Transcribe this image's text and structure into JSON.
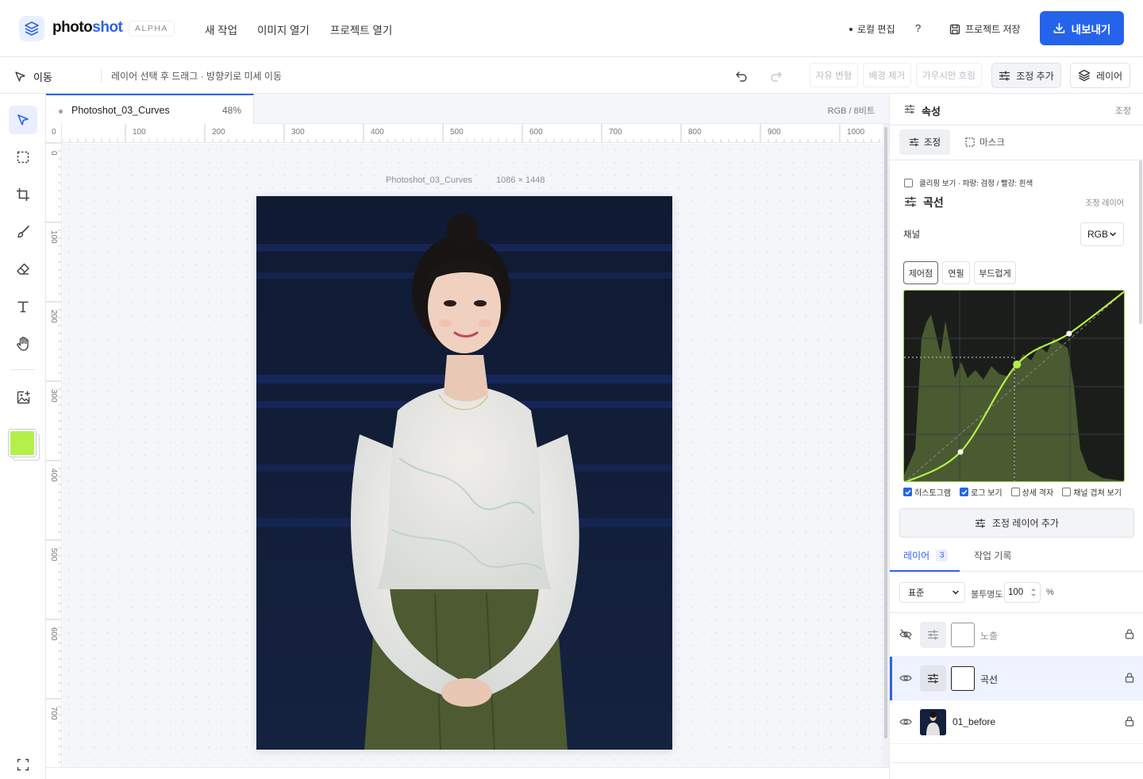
{
  "header": {
    "brand_main": "photo",
    "brand_accent": "shot",
    "badge": "ALPHA",
    "nav": [
      "새 작업",
      "이미지 열기",
      "프로젝트 열기"
    ],
    "local_edit": "로컬 편집",
    "help": "?",
    "save_project": "프로젝트 저장",
    "export": "내보내기"
  },
  "toolbar": {
    "tool_name": "이동",
    "hint": "레이어 선택 후 드래그 · 방향키로 미세 이동",
    "disabled_chips": [
      "자유 변형",
      "배경 제거",
      "가우시안 흐림"
    ],
    "add_adjustment": "조정 추가",
    "layers": "레이어"
  },
  "tools": {
    "items": [
      "move-tool",
      "marquee-tool",
      "crop-tool",
      "brush-tool",
      "eraser-tool",
      "type-tool",
      "hand-tool",
      "add-image-tool"
    ],
    "foreground_color": "#b4f04a"
  },
  "document": {
    "tab_name": "Photoshot_03_Curves",
    "zoom": "48%",
    "mode": "RGB / 8비트",
    "caption_name": "Photoshot_03_Curves",
    "caption_size": "1086 × 1448",
    "ruler_h": [
      "0",
      "100",
      "200",
      "300",
      "400",
      "500",
      "600",
      "700",
      "800",
      "900",
      "1000"
    ],
    "ruler_v": [
      "0",
      "100",
      "200",
      "300",
      "400",
      "500",
      "600",
      "700"
    ]
  },
  "properties": {
    "title": "속성",
    "subtitle": "조정",
    "tabs": [
      "조정",
      "마스크"
    ],
    "clipping_label": "클리핑 보기 · 파랑: 검정 / 빨강: 흰색",
    "adj_title": "곡선",
    "adj_type": "조정 레이어",
    "channel_label": "채널",
    "channel_value": "RGB",
    "modes": [
      "제어점",
      "연필",
      "부드럽게"
    ],
    "options": [
      {
        "label": "히스토그램",
        "checked": true
      },
      {
        "label": "로그 보기",
        "checked": true
      },
      {
        "label": "상세 격자",
        "checked": false
      },
      {
        "label": "채널 겹쳐 보기",
        "checked": false
      }
    ],
    "add_adjustment_layer": "조정 레이어 추가"
  },
  "layers": {
    "tabs": [
      "레이어",
      "작업 기록"
    ],
    "count": "3",
    "blend_mode": "표준",
    "opacity_label": "불투명도",
    "opacity_value": "100",
    "opacity_unit": "%",
    "items": [
      {
        "name": "노출",
        "visible": false,
        "type": "adjustment"
      },
      {
        "name": "곡선",
        "visible": true,
        "type": "adjustment",
        "selected": true
      },
      {
        "name": "01_before",
        "visible": true,
        "type": "image"
      }
    ]
  },
  "colors": {
    "accent": "#2563eb",
    "curve": "#b4f04a",
    "histogram": "#4d5e33"
  }
}
